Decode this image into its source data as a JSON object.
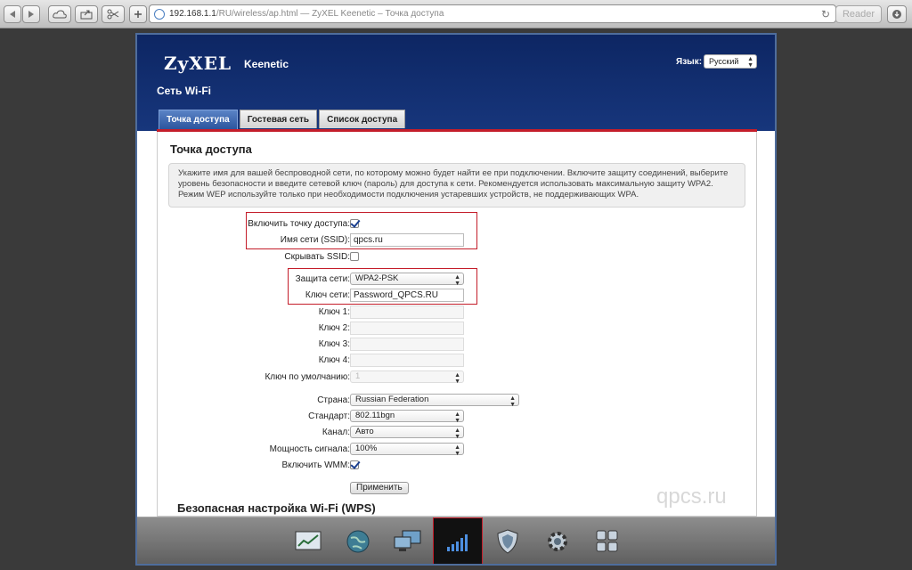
{
  "browser": {
    "url_main": "192.168.1.1",
    "url_path": "/RU/wireless/ap.html — ZyXEL Keenetic – Точка доступа",
    "reader_label": "Reader"
  },
  "header": {
    "logo": "ZyXEL",
    "product": "Keenetic",
    "page_title": "Сеть Wi-Fi",
    "language_label": "Язык:",
    "language_value": "Русский"
  },
  "tabs": [
    {
      "label": "Точка доступа",
      "active": true
    },
    {
      "label": "Гостевая сеть",
      "active": false
    },
    {
      "label": "Список доступа",
      "active": false
    }
  ],
  "section": {
    "title": "Точка доступа",
    "info_lines": [
      "Укажите имя для вашей беспроводной сети, по которому можно будет найти ее при подключении. Включите защиту соединений, выберите",
      "уровень безопасности и введите сетевой ключ (пароль) для доступа к сети. Рекомендуется использовать максимальную защиту WPA2.",
      "Режим WEP используйте только при необходимости подключения устаревших устройств, не поддерживающих WPA."
    ]
  },
  "form": {
    "enable_ap_label": "Включить точку доступа:",
    "enable_ap_checked": true,
    "ssid_label": "Имя сети (SSID):",
    "ssid_value": "qpcs.ru",
    "hide_ssid_label": "Скрывать SSID:",
    "hide_ssid_checked": false,
    "security_label": "Защита сети:",
    "security_value": "WPA2-PSK",
    "key_label": "Ключ сети:",
    "key_value": "Password_QPCS.RU",
    "key1_label": "Ключ 1:",
    "key2_label": "Ключ 2:",
    "key3_label": "Ключ 3:",
    "key4_label": "Ключ 4:",
    "default_key_label": "Ключ по умолчанию:",
    "default_key_value": "1",
    "country_label": "Страна:",
    "country_value": "Russian Federation",
    "standard_label": "Стандарт:",
    "standard_value": "802.11bgn",
    "channel_label": "Канал:",
    "channel_value": "Авто",
    "power_label": "Мощность сигнала:",
    "power_value": "100%",
    "wmm_label": "Включить WMM:",
    "wmm_checked": true,
    "apply_label": "Применить"
  },
  "wps_title": "Безопасная настройка Wi-Fi (WPS)",
  "watermark": "qpcs.ru",
  "dock": [
    {
      "icon": "monitor-chart-icon",
      "active": false
    },
    {
      "icon": "globe-icon",
      "active": false
    },
    {
      "icon": "network-computers-icon",
      "active": false
    },
    {
      "icon": "wifi-signal-icon",
      "active": true
    },
    {
      "icon": "shield-icon",
      "active": false
    },
    {
      "icon": "gear-icon",
      "active": false
    },
    {
      "icon": "apps-grid-icon",
      "active": false
    }
  ],
  "colors": {
    "header_blue": "#0d2663",
    "accent_red": "#c41d2a",
    "tab_active": "#2c559d"
  }
}
